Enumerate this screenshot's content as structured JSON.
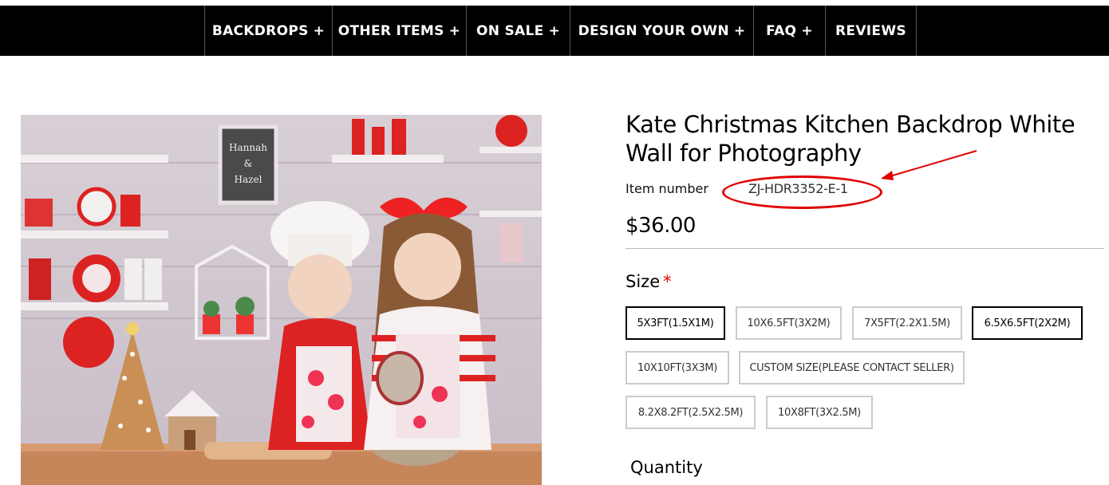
{
  "nav": {
    "items": [
      {
        "label": "BACKDROPS",
        "plus": "+"
      },
      {
        "label": "OTHER ITEMS",
        "plus": "+"
      },
      {
        "label": "ON SALE",
        "plus": "+"
      },
      {
        "label": "DESIGN YOUR OWN",
        "plus": "+"
      },
      {
        "label": "FAQ",
        "plus": "+"
      },
      {
        "label": "REVIEWS",
        "plus": ""
      }
    ]
  },
  "product": {
    "title": "Kate Christmas Kitchen Backdrop White Wall for Photography",
    "item_label": "Item number",
    "item_number": "ZJ-HDR3352-E-1",
    "price": "$36.00",
    "size_label": "Size",
    "required_mark": "*",
    "sizes": [
      {
        "label": "5X3FT(1.5X1M)",
        "selected": true
      },
      {
        "label": "10X6.5FT(3X2M)",
        "selected": false
      },
      {
        "label": "7X5FT(2.2X1.5M)",
        "selected": false
      },
      {
        "label": "6.5X6.5FT(2X2M)",
        "selected": true
      },
      {
        "label": "10X10FT(3X3M)",
        "selected": false
      },
      {
        "label": "CUSTOM SIZE(PLEASE CONTACT SELLER)",
        "selected": false
      },
      {
        "label": "8.2X8.2FT(2.5X2.5M)",
        "selected": false
      },
      {
        "label": "10X8FT(3X2.5M)",
        "selected": false
      }
    ],
    "quantity_label": "Quantity"
  },
  "image": {
    "chalkboard_text_1": "Hannah",
    "chalkboard_text_2": "&",
    "chalkboard_text_3": "Hazel"
  },
  "colors": {
    "accent_red": "#e00000",
    "nav_bg": "#000000"
  }
}
